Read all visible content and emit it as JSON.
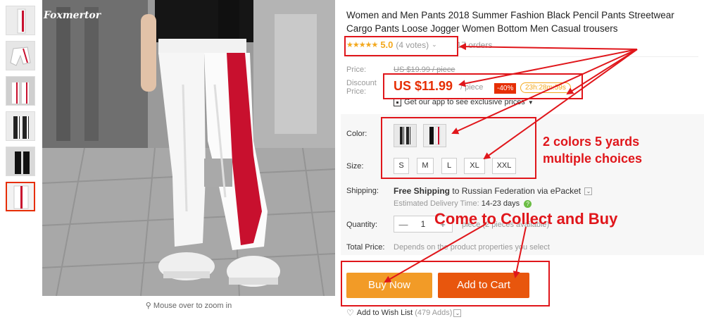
{
  "gallery": {
    "logo_text": "Foxmertor",
    "zoom_hint": "Mouse over to zoom in"
  },
  "product": {
    "title": "Women and Men Pants 2018 Summer Fashion Black Pencil Pants Streetwear Cargo Pants Loose Jogger Women Bottom Men Casual trousers",
    "rating_stars": "★★★★★",
    "rating_value": "5.0",
    "votes": "(4 votes)",
    "orders": "17 orders"
  },
  "price": {
    "price_label": "Price:",
    "original_price": "US $19.99 / piece",
    "discount_label_1": "Discount",
    "discount_label_2": "Price:",
    "discount_price": "US $11.99",
    "per_piece": "/ piece",
    "discount_badge": "-40%",
    "timer": "23h:28m:59s",
    "app_link": "Get our app to see exclusive prices"
  },
  "sku": {
    "color_label": "Color:",
    "size_label": "Size:",
    "sizes": [
      "S",
      "M",
      "L",
      "XL",
      "XXL"
    ]
  },
  "shipping": {
    "label": "Shipping:",
    "free_shipping": "Free Shipping",
    "destination": "to Russian Federation via ePacket",
    "delivery_label": "Estimated Delivery Time:",
    "delivery_days": "14-23 days",
    "help_glyph": "?"
  },
  "quantity": {
    "label": "Quantity:",
    "minus": "—",
    "value": "1",
    "plus": "+",
    "available": "piece (2 pieces available)"
  },
  "total": {
    "label": "Total Price:",
    "text": "Depends on the product properties you select"
  },
  "actions": {
    "buy_now": "Buy Now",
    "add_to_cart": "Add to Cart",
    "wishlist": "Add to Wish List",
    "wishlist_count": "(479 Adds)"
  },
  "annotations": {
    "colors_sizes": "2 colors 5 yards",
    "multiple": "multiple choices",
    "collect": "Come to Collect and Buy",
    "color": "#e0161b"
  },
  "colors": {
    "accent": "#e62e04",
    "buy_now": "#f29b27",
    "add_to_cart": "#e8560d",
    "star": "#f3a81d"
  }
}
